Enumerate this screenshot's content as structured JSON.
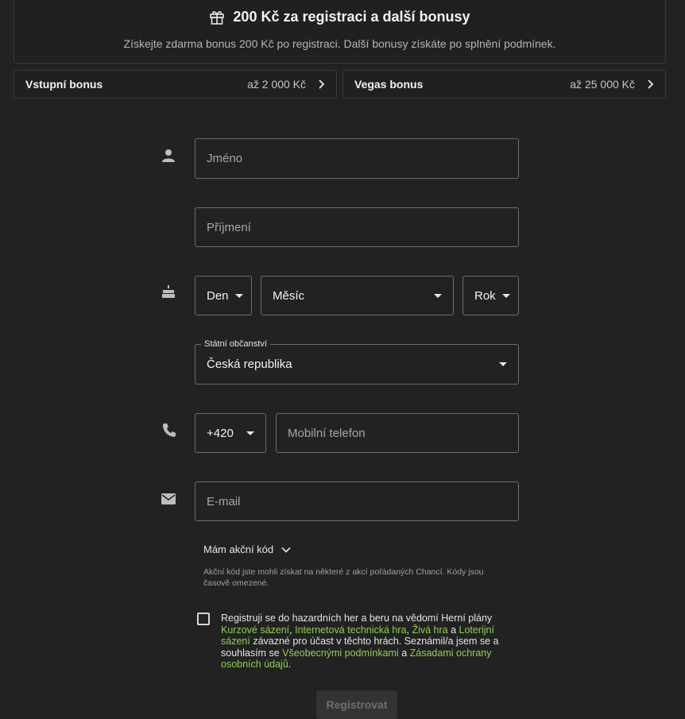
{
  "bonus": {
    "title": "200 Kč za registraci a další bonusy",
    "subtitle": "Získejte zdarma bonus 200 Kč po registraci. Další bonusy získáte po splnění podmínek."
  },
  "bonus_rows": [
    {
      "name": "Vstupní bonus",
      "amount": "až 2 000 Kč"
    },
    {
      "name": "Vegas bonus",
      "amount": "až 25 000 Kč"
    }
  ],
  "form": {
    "first_name": "Jméno",
    "last_name": "Příjmení",
    "day": "Den",
    "month": "Měsíc",
    "year": "Rok",
    "citizenship_label": "Státní občanství",
    "citizenship_value": "Česká republika",
    "phone_prefix": "+420",
    "phone": "Mobilní telefon",
    "email": "E-mail"
  },
  "promo": {
    "label": "Mám akční kód",
    "note": "Akční kód jste mohli získat na některé z akcí pořádaných Chancí. Kódy jsou časově omezené."
  },
  "consent": {
    "part1": "Registruji se do hazardních her a beru na vědomí Herní plány ",
    "link1": "Kurzové sázení",
    "sep1": ", ",
    "link2": "Internetová technická hra",
    "sep2": ", ",
    "link3": "Živá hra",
    "sep3": " a ",
    "link4": "Loterijní sázení",
    "part2": " závazné pro účast v těchto hrách. Seznámil/a jsem se a souhlasím se ",
    "link5": "Všeobecnými podmínkami",
    "part3": " a ",
    "link6": "Zásadami ochrany osobních údajů",
    "part4": "."
  },
  "submit": "Registrovat",
  "colors": {
    "background": "#222222",
    "link": "#8fd14f",
    "border": "#6d6d6d"
  }
}
